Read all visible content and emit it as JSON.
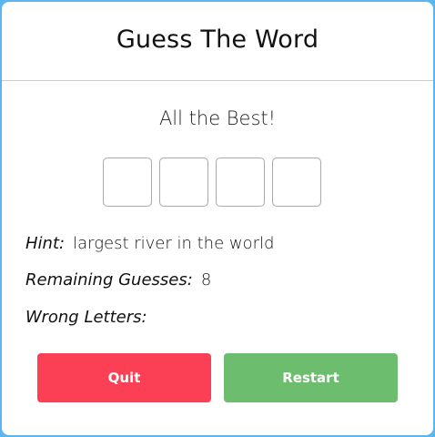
{
  "game": {
    "title": "Guess The Word",
    "subtitle": "All the Best!",
    "letters": [
      "",
      "",
      "",
      ""
    ],
    "hint_label": "Hint:",
    "hint_value": "largest river in the world",
    "remaining_label": "Remaining Guesses:",
    "remaining_value": "8",
    "wrong_label": "Wrong Letters:",
    "wrong_value": ""
  },
  "buttons": {
    "quit": "Quit",
    "restart": "Restart"
  },
  "colors": {
    "background": "#5bb6f0",
    "quit": "#fb4055",
    "restart": "#6dbd6f"
  }
}
